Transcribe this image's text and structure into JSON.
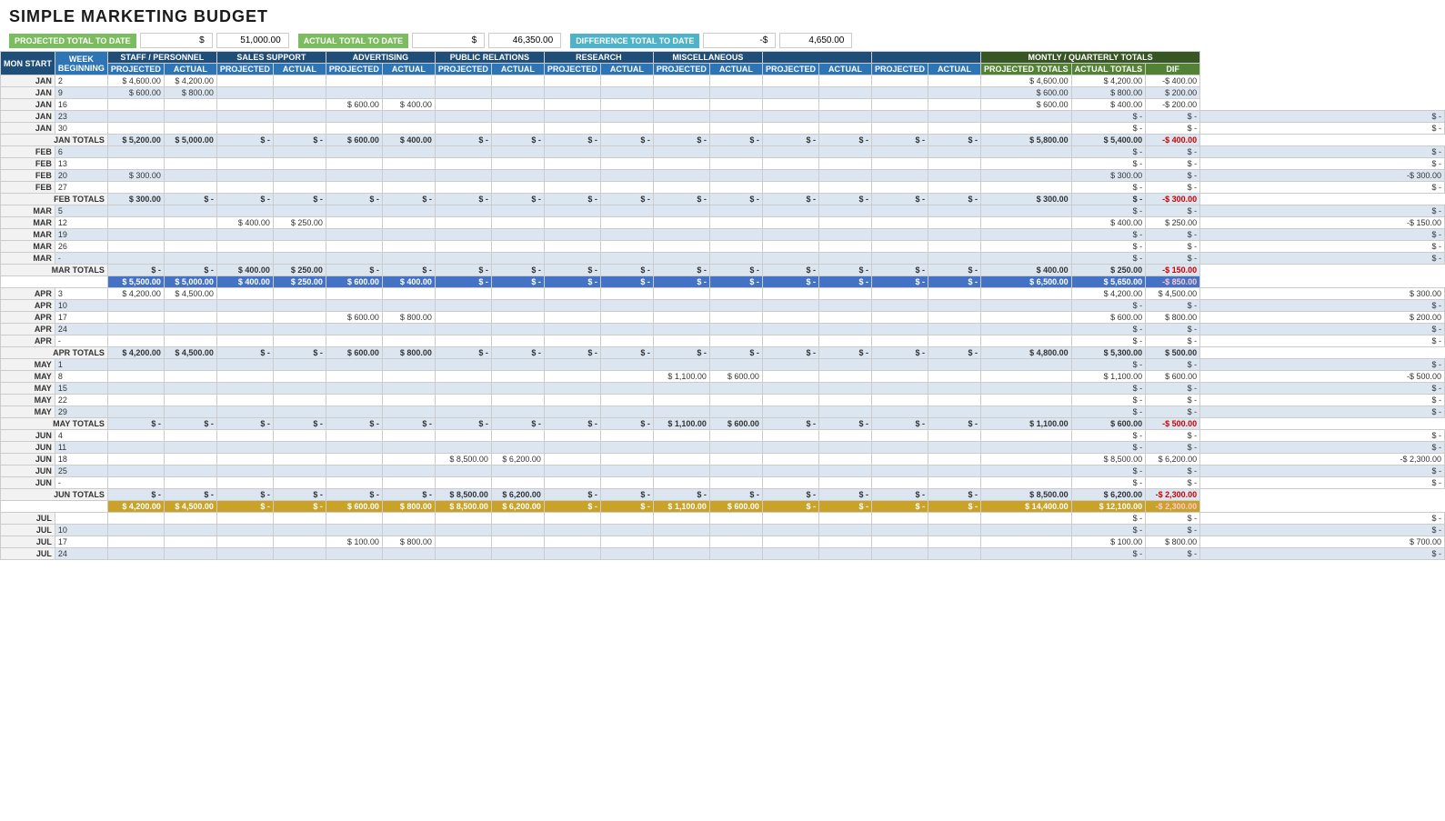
{
  "title": "SIMPLE MARKETING BUDGET",
  "summary": {
    "projected_label": "PROJECTED TOTAL TO DATE",
    "projected_sign": "$",
    "projected_value": "51,000.00",
    "actual_label": "ACTUAL TOTAL TO DATE",
    "actual_sign": "$",
    "actual_value": "46,350.00",
    "diff_label": "DIFFERENCE TOTAL TO DATE",
    "diff_sign": "-$",
    "diff_value": "4,650.00"
  },
  "col_headers": {
    "mon_start": "MON START",
    "week_beginning": "WEEK BEGINNING",
    "staff": "STAFF / PERSONNEL",
    "sales": "SALES SUPPORT",
    "advertising": "ADVERTISING",
    "pr": "PUBLIC RELATIONS",
    "research": "RESEARCH",
    "misc": "MISCELLANEOUS",
    "col1": "",
    "col2": "",
    "col3": "",
    "col4": "",
    "monthly": "MONTLY / QUARTERLY TOTALS",
    "projected": "PROJECTED",
    "actual": "ACTUAL",
    "projected_totals": "PROJECTED TOTALS",
    "actual_totals": "ACTUAL TOTALS",
    "dif": "DIF"
  }
}
